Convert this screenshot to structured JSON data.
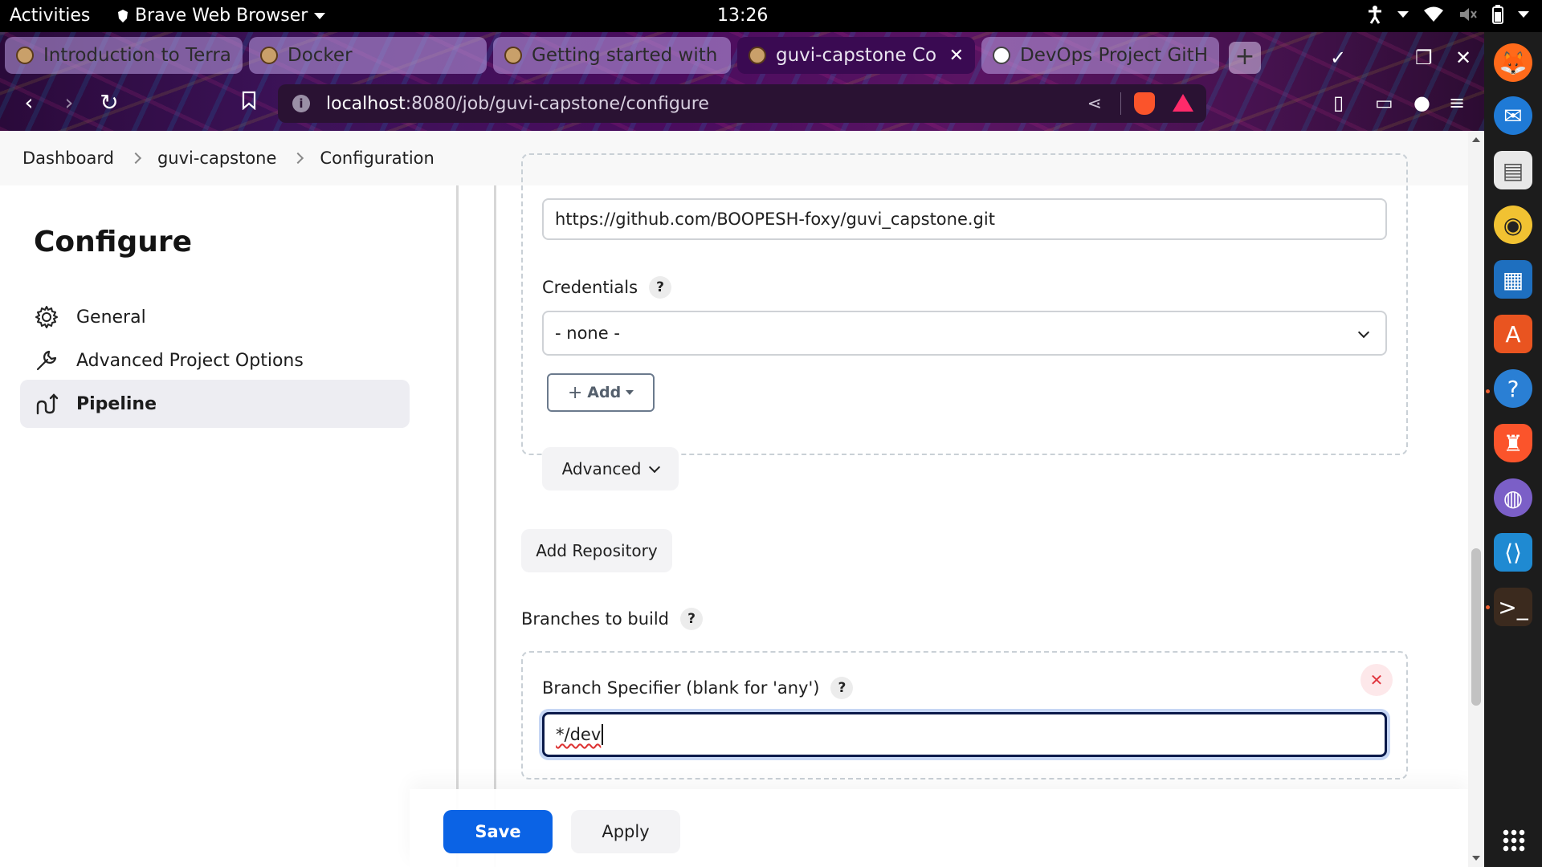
{
  "system": {
    "activities": "Activities",
    "app_menu": "Brave Web Browser",
    "clock": "13:26"
  },
  "browser": {
    "tabs": [
      {
        "label": "Introduction to Terra",
        "active": false
      },
      {
        "label": "Docker",
        "active": false
      },
      {
        "label": "Getting started with",
        "active": false
      },
      {
        "label": "guvi-capstone Co",
        "active": true
      },
      {
        "label": "DevOps Project GitH",
        "active": false
      }
    ],
    "url_host": "localhost",
    "url_path": ":8080/job/guvi-capstone/configure"
  },
  "breadcrumb": [
    "Dashboard",
    "guvi-capstone",
    "Configuration"
  ],
  "sidebar": {
    "title": "Configure",
    "items": [
      {
        "label": "General",
        "icon": "gear-icon"
      },
      {
        "label": "Advanced Project Options",
        "icon": "wrench-icon"
      },
      {
        "label": "Pipeline",
        "icon": "pipeline-icon",
        "active": true
      }
    ]
  },
  "scm": {
    "repo_url": "https://github.com/BOOPESH-foxy/guvi_capstone.git",
    "credentials_label": "Credentials",
    "credentials_value": "- none -",
    "add_label": "Add",
    "advanced_label": "Advanced",
    "add_repository_label": "Add Repository",
    "branches_label": "Branches to build",
    "branch_specifier_label": "Branch Specifier (blank for 'any')",
    "branch_specifier_value": "*/dev",
    "help_glyph": "?"
  },
  "footer": {
    "save_label": "Save",
    "apply_label": "Apply"
  },
  "colors": {
    "primary": "#0b63e5",
    "focus_ring": "#c6d6f4",
    "danger": "#e0363f"
  }
}
